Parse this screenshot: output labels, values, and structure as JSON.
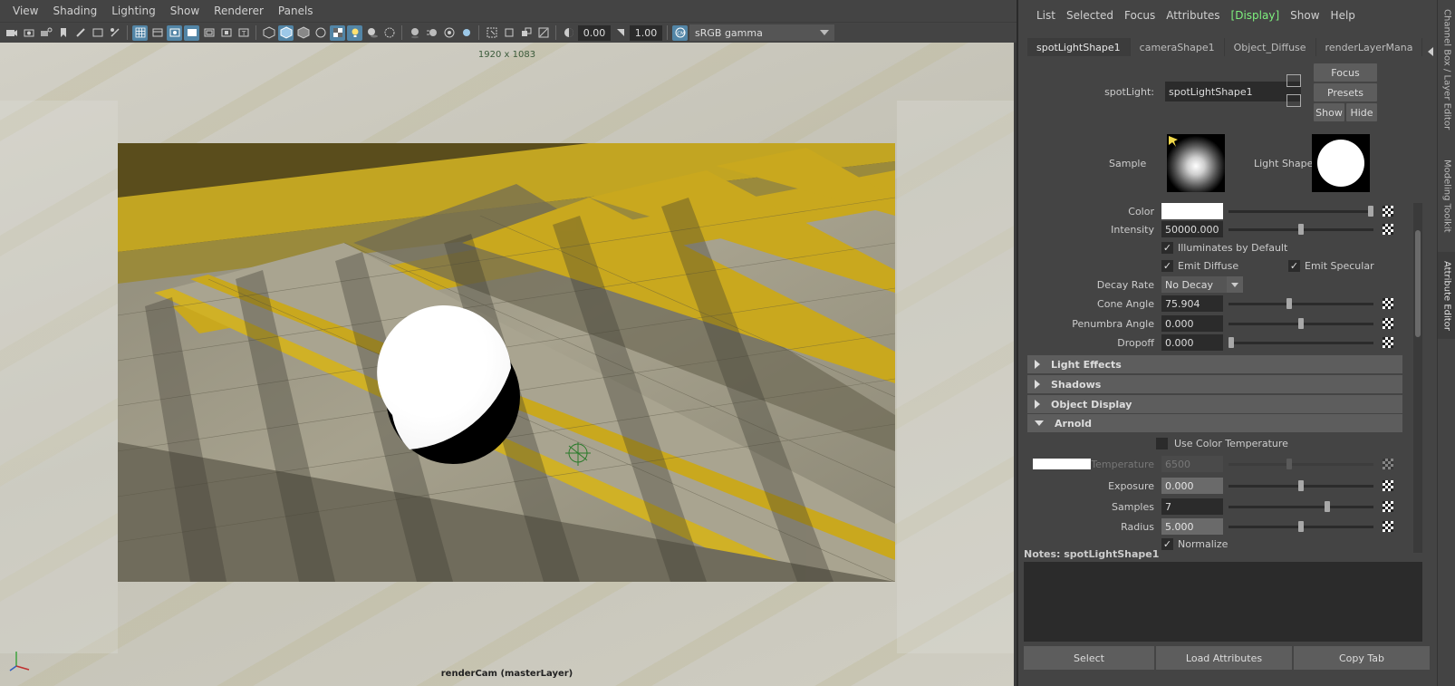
{
  "viewport": {
    "menu": [
      "View",
      "Shading",
      "Lighting",
      "Show",
      "Renderer",
      "Panels"
    ],
    "toolbar": {
      "exposure": "0.00",
      "gamma": "1.00",
      "color_space": "sRGB gamma"
    },
    "resolution_label": "1920 x 1083",
    "camera_label": "renderCam (masterLayer)"
  },
  "attribute_editor": {
    "menu": [
      "List",
      "Selected",
      "Focus",
      "Attributes",
      "[Display]",
      "Show",
      "Help"
    ],
    "tabs": [
      "spotLightShape1",
      "cameraShape1",
      "Object_Diffuse",
      "renderLayerMana"
    ],
    "node_type_label": "spotLight:",
    "node_name": "spotLightShape1",
    "buttons": {
      "focus": "Focus",
      "presets": "Presets",
      "show": "Show",
      "hide": "Hide"
    },
    "sample_label": "Sample",
    "light_shape_label": "Light Shape",
    "attributes": {
      "color_label": "Color",
      "intensity_label": "Intensity",
      "intensity": "50000.000",
      "illuminates_label": "Illuminates by Default",
      "emit_diffuse_label": "Emit Diffuse",
      "emit_specular_label": "Emit Specular",
      "decay_rate_label": "Decay Rate",
      "decay_rate": "No Decay",
      "cone_angle_label": "Cone Angle",
      "cone_angle": "75.904",
      "penumbra_label": "Penumbra Angle",
      "penumbra": "0.000",
      "dropoff_label": "Dropoff",
      "dropoff": "0.000"
    },
    "sections": [
      "Light Effects",
      "Shadows",
      "Object Display",
      "Arnold"
    ],
    "arnold": {
      "use_color_temp_label": "Use Color Temperature",
      "temperature_label": "Temperature",
      "temperature": "6500",
      "exposure_label": "Exposure",
      "exposure": "0.000",
      "samples_label": "Samples",
      "samples": "7",
      "radius_label": "Radius",
      "radius": "5.000",
      "normalize_label": "Normalize"
    },
    "notes_label": "Notes:  spotLightShape1",
    "bottom_buttons": {
      "select": "Select",
      "load_attributes": "Load Attributes",
      "copy_tab": "Copy Tab"
    }
  },
  "side_tabs": [
    "Channel Box / Layer Editor",
    "Modeling Toolkit",
    "Attribute Editor"
  ],
  "colors": {
    "panel_bg": "#444444",
    "field_bg": "#2b2b2b",
    "toolbar_active": "#5285a6",
    "display_highlight": "#7ef07e",
    "stair_yellow": "#c9a81e"
  }
}
